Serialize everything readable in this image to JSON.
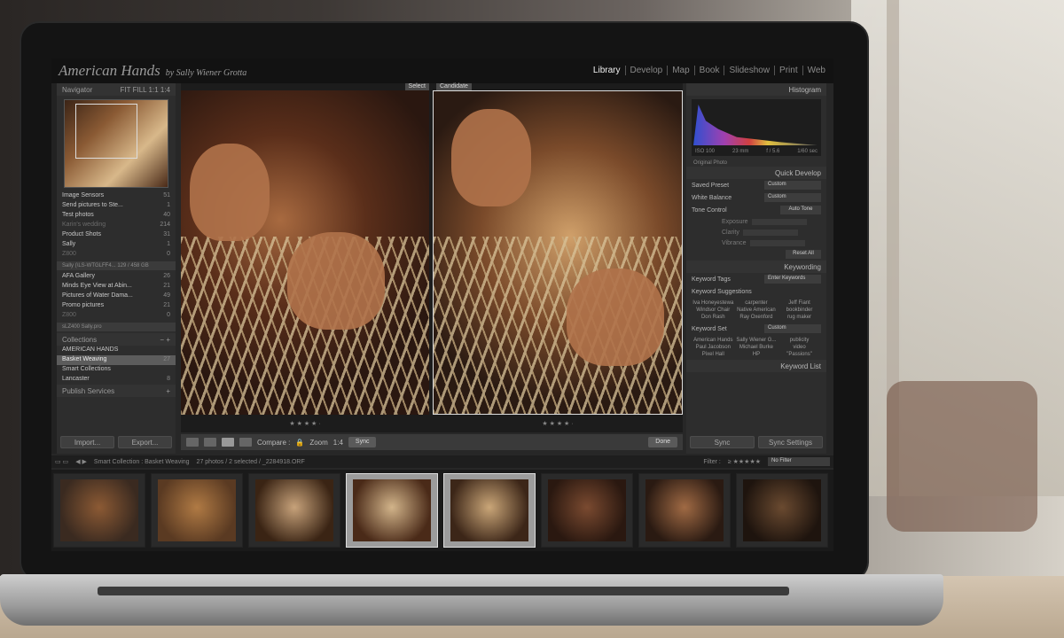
{
  "topbar": {
    "brand": "American Hands",
    "brand_sub": "by Sally Wiener Grotta",
    "modules": [
      "Library",
      "Develop",
      "Map",
      "Book",
      "Slideshow",
      "Print",
      "Web"
    ],
    "active_module": "Library"
  },
  "left_panel": {
    "navigator": {
      "title": "Navigator",
      "zoom": "FIT FILL 1:1 1:4"
    },
    "folders": [
      {
        "name": "Image Sensors",
        "count": "51"
      },
      {
        "name": "Send pictures to Ste...",
        "count": "1"
      },
      {
        "name": "Test photos",
        "count": "40"
      },
      {
        "name": "Karin's wedding",
        "count": "214",
        "dim": true
      },
      {
        "name": "Product Shots",
        "count": "31"
      },
      {
        "name": "Sally",
        "count": "1"
      },
      {
        "name": "Z800",
        "count": "0",
        "dim": true
      }
    ],
    "volume": "Sally (\\LS-WTGLFF4...    129 / 458 GB",
    "folders2": [
      {
        "name": "AFA Gallery",
        "count": "26"
      },
      {
        "name": "Minds Eye View at Abin...",
        "count": "21"
      },
      {
        "name": "Pictures of Water Dama...",
        "count": "49"
      },
      {
        "name": "Promo pictures",
        "count": "21"
      },
      {
        "name": "Z800",
        "count": "0",
        "dim": true
      }
    ],
    "volume2": "sLZ400 Sally.pro",
    "collections": {
      "title": "Collections",
      "items": [
        {
          "name": "AMERICAN HANDS",
          "count": ""
        },
        {
          "name": "Basket Weaving",
          "count": "27",
          "selected": true
        },
        {
          "name": "Smart Collections",
          "count": ""
        },
        {
          "name": "Lancaster",
          "count": "8"
        }
      ]
    },
    "publish_services": "Publish Services",
    "import_label": "Import...",
    "export_label": "Export..."
  },
  "compare": {
    "select_label": "Select",
    "candidate_label": "Candidate",
    "stars_left": "★ ★ ★ ★ ·",
    "stars_right": "★ ★ ★ ★ ·"
  },
  "toolbar": {
    "compare_label": "Compare :",
    "zoom_label": "Zoom",
    "zoom_value": "1:4",
    "sync_label": "Sync",
    "done_label": "Done"
  },
  "right_panel": {
    "histogram": {
      "title": "Histogram",
      "iso": "ISO 100",
      "focal": "23 mm",
      "aperture": "f / 5.6",
      "shutter": "1/60 sec"
    },
    "original_photo": "Original Photo",
    "quick_develop": {
      "title": "Quick Develop",
      "saved_preset_label": "Saved Preset",
      "saved_preset_value": "Custom",
      "white_balance_label": "White Balance",
      "white_balance_value": "Custom",
      "tone_control_label": "Tone Control",
      "auto_tone": "Auto Tone",
      "exposure": "Exposure",
      "clarity": "Clarity",
      "vibrance": "Vibrance",
      "reset_all": "Reset All"
    },
    "keywording": {
      "title": "Keywording",
      "keyword_tags_label": "Keyword Tags",
      "keyword_tags_value": "Enter Keywords",
      "suggestions_title": "Keyword Suggestions",
      "suggestions": [
        "Iva Honeyestewa",
        "carpenter",
        "Jeff Fiant",
        "Windsor Chair",
        "Native American",
        "bookbinder",
        "Don Rash",
        "Ray Oxenford",
        "rug maker"
      ],
      "keyword_set_label": "Keyword Set",
      "keyword_set_value": "Custom",
      "set_tags": [
        "American Hands",
        "Sally Wiener G...",
        "publicity",
        "Paul Jacobson",
        "Michael Burke",
        "video",
        "Pixel Hall",
        "HP",
        "\"Passions\""
      ]
    },
    "keyword_list": "Keyword List",
    "sync_label": "Sync",
    "sync_settings_label": "Sync Settings"
  },
  "filmstrip_bar": {
    "source": "Smart Collection : Basket Weaving",
    "info": "27 photos / 2 selected / _2284918.ORF",
    "filter_label": "Filter :",
    "filter_value": "No Filter"
  },
  "thumbnails": [
    {
      "colors": "#3a2a20,#8c5a34",
      "selected": false
    },
    {
      "colors": "#5a3a22,#b07a44",
      "selected": false
    },
    {
      "colors": "#3a2414,#c7a27a",
      "selected": false
    },
    {
      "colors": "#4a2a18,#d2b48a",
      "selected": true
    },
    {
      "colors": "#3c2618,#caa678",
      "selected": true
    },
    {
      "colors": "#2a1810,#7a4a30",
      "selected": false
    },
    {
      "colors": "#2a1a12,#a06a44",
      "selected": false
    },
    {
      "colors": "#1e140e,#6a4a30",
      "selected": false
    }
  ]
}
